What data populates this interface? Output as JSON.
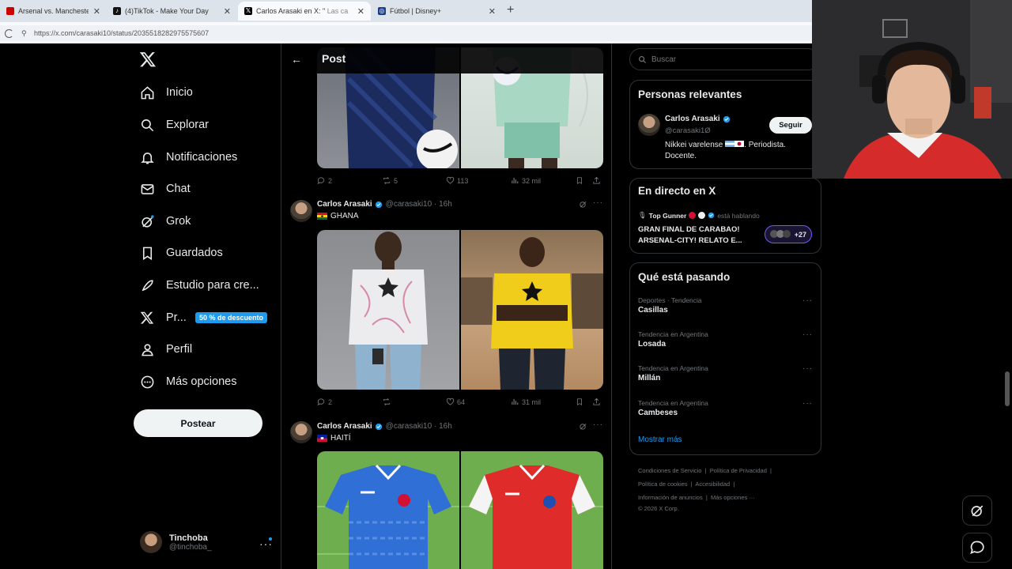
{
  "browser": {
    "tabs": [
      {
        "label": "Arsenal vs. Manchester City | F",
        "favicon": "sports-icon",
        "active": false
      },
      {
        "label": "(4)TikTok - Make Your Day",
        "favicon": "tiktok-icon",
        "active": false
      },
      {
        "label": "Carlos Arasaki en X: \"",
        "label_tail": "Las ca",
        "favicon": "x-icon",
        "active": true
      },
      {
        "label": "Fútbol | Disney+",
        "favicon": "disney-icon",
        "active": false
      }
    ],
    "new_tab": "+",
    "url": "https://x.com/carasaki10/status/2035518282975575607"
  },
  "nav": {
    "items": [
      {
        "label": "Inicio",
        "icon": "home-icon"
      },
      {
        "label": "Explorar",
        "icon": "search-icon"
      },
      {
        "label": "Notificaciones",
        "icon": "bell-icon"
      },
      {
        "label": "Chat",
        "icon": "mail-icon"
      },
      {
        "label": "Grok",
        "icon": "grok-icon"
      },
      {
        "label": "Guardados",
        "icon": "bookmark-icon"
      },
      {
        "label": "Estudio para cre...",
        "icon": "rocket-icon"
      },
      {
        "label": "Pr...",
        "icon": "x-premium-icon"
      },
      {
        "label": "Perfil",
        "icon": "user-icon"
      },
      {
        "label": "Más opciones",
        "icon": "more-circle-icon"
      }
    ],
    "promo_badge": "50 % de descuento",
    "post_button": "Postear",
    "account": {
      "name": "Tinchoba",
      "handle": "@tinchoba_",
      "more": "···"
    }
  },
  "header": {
    "title": "Post",
    "back": "←"
  },
  "tweets": [
    {
      "name": "",
      "stats": {
        "replies": "2",
        "reposts": "5",
        "likes": "113",
        "views": "32 mil"
      }
    },
    {
      "name": "Carlos Arasaki",
      "handle": "@carasaki10",
      "time": "· 16h",
      "text": "GHANA",
      "stats": {
        "replies": "2",
        "reposts": "",
        "likes": "64",
        "views": "31 mil"
      }
    },
    {
      "name": "Carlos Arasaki",
      "handle": "@carasaki10",
      "time": "· 16h",
      "text": "HAITÍ"
    }
  ],
  "right": {
    "search_placeholder": "Buscar",
    "relevant": {
      "title": "Personas relevantes",
      "name": "Carlos Arasaki",
      "handle": "@carasaki1Ø",
      "bio_1": "Nikkei varelense",
      "bio_2": ". Periodista.",
      "bio_3": "Docente.",
      "follow": "Seguir"
    },
    "live": {
      "title": "En directo en X",
      "host": "Top Gunner",
      "status": "está hablando",
      "line1": "GRAN FINAL DE CARABAO!",
      "line2": "ARSENAL-CITY! RELATO E...",
      "count": "+27"
    },
    "trends": {
      "title": "Qué está pasando",
      "items": [
        {
          "category": "Deportes · Tendencia",
          "name": "Casillas"
        },
        {
          "category": "Tendencia en Argentina",
          "name": "Losada"
        },
        {
          "category": "Tendencia en Argentina",
          "name": "Millán"
        },
        {
          "category": "Tendencia en Argentina",
          "name": "Cambeses"
        }
      ],
      "more": "Mostrar más"
    },
    "footer": {
      "links_1": [
        "Condiciones de Servicio",
        "Política de Privacidad"
      ],
      "links_2": [
        "Política de cookies",
        "Accesibilidad"
      ],
      "links_3": [
        "Información de anuncios",
        "Más opciones ···"
      ],
      "copyright": "© 2026 X Corp."
    }
  },
  "colors": {
    "accent": "#1d9bf0",
    "bg": "#000000",
    "border": "#2f3336",
    "muted": "#71767b"
  }
}
